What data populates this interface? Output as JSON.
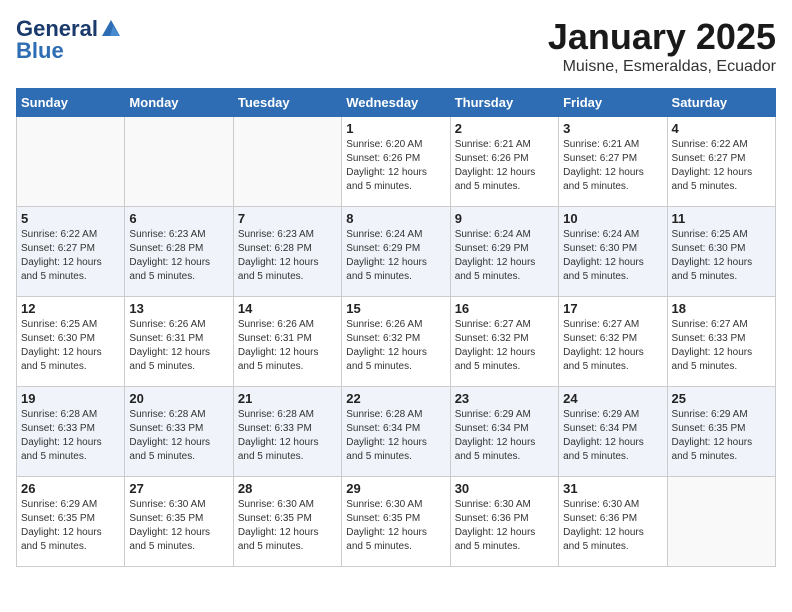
{
  "header": {
    "logo_line1": "General",
    "logo_line2": "Blue",
    "month": "January 2025",
    "location": "Muisne, Esmeraldas, Ecuador"
  },
  "weekdays": [
    "Sunday",
    "Monday",
    "Tuesday",
    "Wednesday",
    "Thursday",
    "Friday",
    "Saturday"
  ],
  "weeks": [
    [
      {
        "day": "",
        "sunrise": "",
        "sunset": "",
        "daylight": "",
        "empty": true
      },
      {
        "day": "",
        "sunrise": "",
        "sunset": "",
        "daylight": "",
        "empty": true
      },
      {
        "day": "",
        "sunrise": "",
        "sunset": "",
        "daylight": "",
        "empty": true
      },
      {
        "day": "1",
        "sunrise": "Sunrise: 6:20 AM",
        "sunset": "Sunset: 6:26 PM",
        "daylight": "Daylight: 12 hours and 5 minutes.",
        "empty": false
      },
      {
        "day": "2",
        "sunrise": "Sunrise: 6:21 AM",
        "sunset": "Sunset: 6:26 PM",
        "daylight": "Daylight: 12 hours and 5 minutes.",
        "empty": false
      },
      {
        "day": "3",
        "sunrise": "Sunrise: 6:21 AM",
        "sunset": "Sunset: 6:27 PM",
        "daylight": "Daylight: 12 hours and 5 minutes.",
        "empty": false
      },
      {
        "day": "4",
        "sunrise": "Sunrise: 6:22 AM",
        "sunset": "Sunset: 6:27 PM",
        "daylight": "Daylight: 12 hours and 5 minutes.",
        "empty": false
      }
    ],
    [
      {
        "day": "5",
        "sunrise": "Sunrise: 6:22 AM",
        "sunset": "Sunset: 6:27 PM",
        "daylight": "Daylight: 12 hours and 5 minutes.",
        "empty": false
      },
      {
        "day": "6",
        "sunrise": "Sunrise: 6:23 AM",
        "sunset": "Sunset: 6:28 PM",
        "daylight": "Daylight: 12 hours and 5 minutes.",
        "empty": false
      },
      {
        "day": "7",
        "sunrise": "Sunrise: 6:23 AM",
        "sunset": "Sunset: 6:28 PM",
        "daylight": "Daylight: 12 hours and 5 minutes.",
        "empty": false
      },
      {
        "day": "8",
        "sunrise": "Sunrise: 6:24 AM",
        "sunset": "Sunset: 6:29 PM",
        "daylight": "Daylight: 12 hours and 5 minutes.",
        "empty": false
      },
      {
        "day": "9",
        "sunrise": "Sunrise: 6:24 AM",
        "sunset": "Sunset: 6:29 PM",
        "daylight": "Daylight: 12 hours and 5 minutes.",
        "empty": false
      },
      {
        "day": "10",
        "sunrise": "Sunrise: 6:24 AM",
        "sunset": "Sunset: 6:30 PM",
        "daylight": "Daylight: 12 hours and 5 minutes.",
        "empty": false
      },
      {
        "day": "11",
        "sunrise": "Sunrise: 6:25 AM",
        "sunset": "Sunset: 6:30 PM",
        "daylight": "Daylight: 12 hours and 5 minutes.",
        "empty": false
      }
    ],
    [
      {
        "day": "12",
        "sunrise": "Sunrise: 6:25 AM",
        "sunset": "Sunset: 6:30 PM",
        "daylight": "Daylight: 12 hours and 5 minutes.",
        "empty": false
      },
      {
        "day": "13",
        "sunrise": "Sunrise: 6:26 AM",
        "sunset": "Sunset: 6:31 PM",
        "daylight": "Daylight: 12 hours and 5 minutes.",
        "empty": false
      },
      {
        "day": "14",
        "sunrise": "Sunrise: 6:26 AM",
        "sunset": "Sunset: 6:31 PM",
        "daylight": "Daylight: 12 hours and 5 minutes.",
        "empty": false
      },
      {
        "day": "15",
        "sunrise": "Sunrise: 6:26 AM",
        "sunset": "Sunset: 6:32 PM",
        "daylight": "Daylight: 12 hours and 5 minutes.",
        "empty": false
      },
      {
        "day": "16",
        "sunrise": "Sunrise: 6:27 AM",
        "sunset": "Sunset: 6:32 PM",
        "daylight": "Daylight: 12 hours and 5 minutes.",
        "empty": false
      },
      {
        "day": "17",
        "sunrise": "Sunrise: 6:27 AM",
        "sunset": "Sunset: 6:32 PM",
        "daylight": "Daylight: 12 hours and 5 minutes.",
        "empty": false
      },
      {
        "day": "18",
        "sunrise": "Sunrise: 6:27 AM",
        "sunset": "Sunset: 6:33 PM",
        "daylight": "Daylight: 12 hours and 5 minutes.",
        "empty": false
      }
    ],
    [
      {
        "day": "19",
        "sunrise": "Sunrise: 6:28 AM",
        "sunset": "Sunset: 6:33 PM",
        "daylight": "Daylight: 12 hours and 5 minutes.",
        "empty": false
      },
      {
        "day": "20",
        "sunrise": "Sunrise: 6:28 AM",
        "sunset": "Sunset: 6:33 PM",
        "daylight": "Daylight: 12 hours and 5 minutes.",
        "empty": false
      },
      {
        "day": "21",
        "sunrise": "Sunrise: 6:28 AM",
        "sunset": "Sunset: 6:33 PM",
        "daylight": "Daylight: 12 hours and 5 minutes.",
        "empty": false
      },
      {
        "day": "22",
        "sunrise": "Sunrise: 6:28 AM",
        "sunset": "Sunset: 6:34 PM",
        "daylight": "Daylight: 12 hours and 5 minutes.",
        "empty": false
      },
      {
        "day": "23",
        "sunrise": "Sunrise: 6:29 AM",
        "sunset": "Sunset: 6:34 PM",
        "daylight": "Daylight: 12 hours and 5 minutes.",
        "empty": false
      },
      {
        "day": "24",
        "sunrise": "Sunrise: 6:29 AM",
        "sunset": "Sunset: 6:34 PM",
        "daylight": "Daylight: 12 hours and 5 minutes.",
        "empty": false
      },
      {
        "day": "25",
        "sunrise": "Sunrise: 6:29 AM",
        "sunset": "Sunset: 6:35 PM",
        "daylight": "Daylight: 12 hours and 5 minutes.",
        "empty": false
      }
    ],
    [
      {
        "day": "26",
        "sunrise": "Sunrise: 6:29 AM",
        "sunset": "Sunset: 6:35 PM",
        "daylight": "Daylight: 12 hours and 5 minutes.",
        "empty": false
      },
      {
        "day": "27",
        "sunrise": "Sunrise: 6:30 AM",
        "sunset": "Sunset: 6:35 PM",
        "daylight": "Daylight: 12 hours and 5 minutes.",
        "empty": false
      },
      {
        "day": "28",
        "sunrise": "Sunrise: 6:30 AM",
        "sunset": "Sunset: 6:35 PM",
        "daylight": "Daylight: 12 hours and 5 minutes.",
        "empty": false
      },
      {
        "day": "29",
        "sunrise": "Sunrise: 6:30 AM",
        "sunset": "Sunset: 6:35 PM",
        "daylight": "Daylight: 12 hours and 5 minutes.",
        "empty": false
      },
      {
        "day": "30",
        "sunrise": "Sunrise: 6:30 AM",
        "sunset": "Sunset: 6:36 PM",
        "daylight": "Daylight: 12 hours and 5 minutes.",
        "empty": false
      },
      {
        "day": "31",
        "sunrise": "Sunrise: 6:30 AM",
        "sunset": "Sunset: 6:36 PM",
        "daylight": "Daylight: 12 hours and 5 minutes.",
        "empty": false
      },
      {
        "day": "",
        "sunrise": "",
        "sunset": "",
        "daylight": "",
        "empty": true
      }
    ]
  ]
}
